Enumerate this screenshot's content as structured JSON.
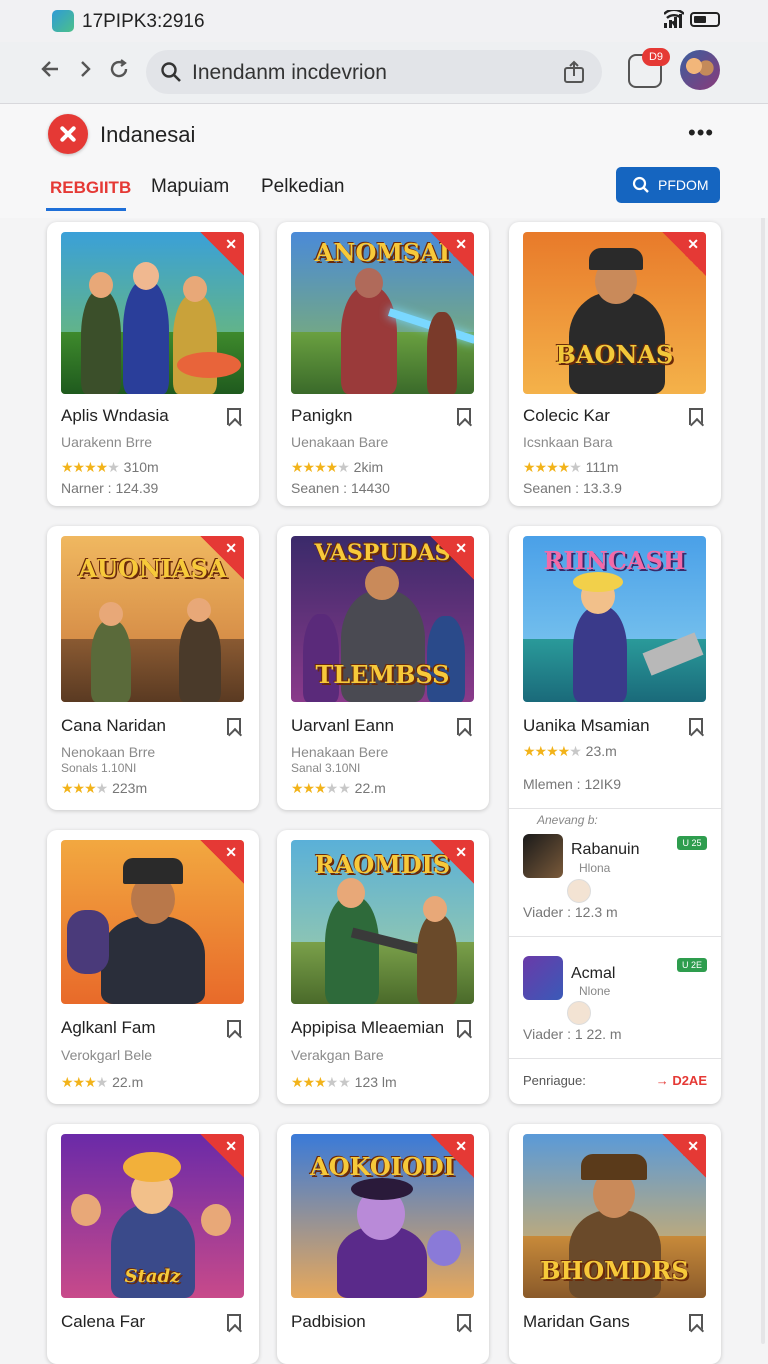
{
  "status_bar": {
    "time": "17PIPK3:2916"
  },
  "browser": {
    "url": "Inendanm incdevrion",
    "tabs_badge": "D9"
  },
  "header": {
    "site_title": "Indanesai",
    "more": "•••"
  },
  "tabs": [
    {
      "label": "REBGIITB",
      "active": true
    },
    {
      "label": "Mapuiam",
      "active": false
    },
    {
      "label": "Pelkedian",
      "active": false
    }
  ],
  "action_button": {
    "label": "PFDOM"
  },
  "colors": {
    "accent_red": "#e53935",
    "accent_blue": "#1565c0",
    "star": "#f2b31a",
    "badge_green": "#2e9d4e"
  },
  "games": [
    {
      "title": "Aplis Wndasia",
      "sub": "Uarakenn Brre",
      "rating": "310m",
      "meta": "Narner : 124.39",
      "art_text": ""
    },
    {
      "title": "Panigkn",
      "sub": "Uenakaan Bare",
      "rating": "2kim",
      "meta": "Seanen : 14430",
      "art_text": "ANOMSAI"
    },
    {
      "title": "Colecic Kar",
      "sub": "Icsnkaan Bara",
      "rating": "111m",
      "meta": "Seanen : 13.3.9",
      "art_text": "BAONAS"
    },
    {
      "title": "Cana Naridan",
      "sub": "Nenokaan Brre",
      "tiny": "Sonals 1.10NI",
      "rating": "223m",
      "art_text": "AUONIASA"
    },
    {
      "title": "Uarvanl Eann",
      "sub": "Henakaan Bere",
      "tiny": "Sanal 3.10NI",
      "rating": "22.m",
      "art_text": "TLEMBSS"
    },
    {
      "title": "Uanika Msamian",
      "rating": "23.m",
      "meta": "Mlemen : 12IK9",
      "art_text": "RIINCASH"
    },
    {
      "title": "Aglkanl Fam",
      "sub": "Verokgarl Bele",
      "rating": "22.m",
      "art_text": ""
    },
    {
      "title": "Appipisa Mleaemian",
      "sub": "Verakgan Bare",
      "rating": "123 lm",
      "art_text": "RAOMDIS"
    },
    {
      "title": "Calena Far",
      "art_text": "Stadz"
    },
    {
      "title": "Padbision",
      "art_text": "AOKOIODI"
    },
    {
      "title": "Maridan Gans",
      "art_text": "BHOMDRS"
    }
  ],
  "side_panel": {
    "heading": "Anevang b:",
    "items": [
      {
        "title": "Rabanuin",
        "sub": "Hlona",
        "badge": "U 25",
        "meta": "Viader : 12.3 m"
      },
      {
        "title": "Acmal",
        "sub": "Nlone",
        "badge": "U 2E",
        "meta": "Viader : 1 22. m"
      }
    ],
    "footer_label": "Penriague:",
    "footer_link": "→ D2AE"
  }
}
